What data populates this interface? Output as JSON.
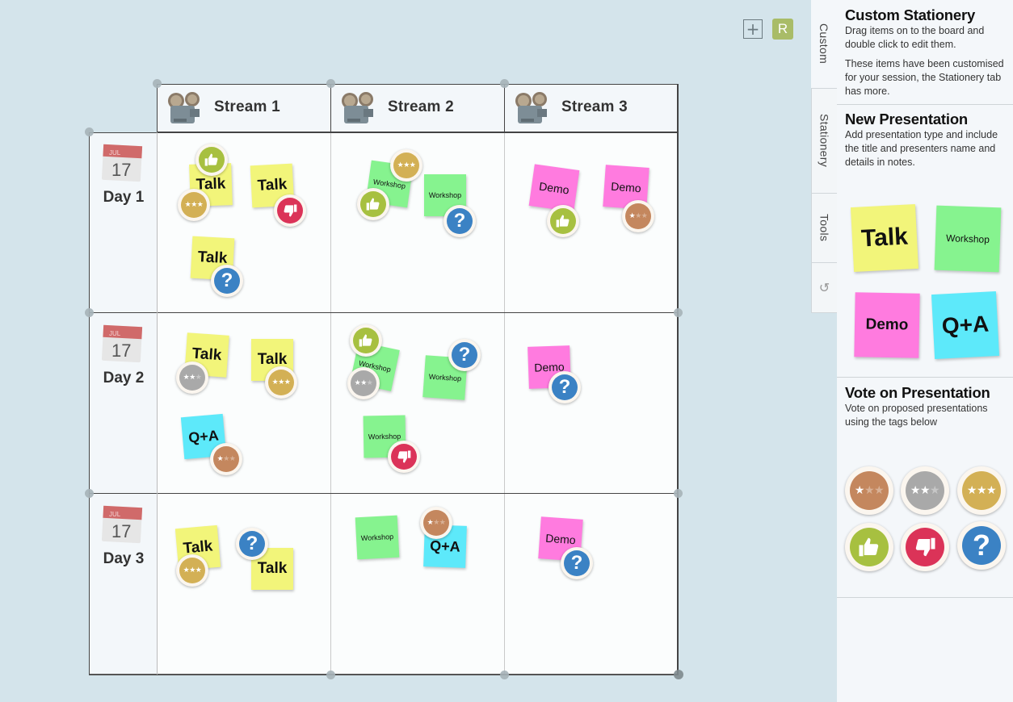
{
  "board": {
    "controls": {
      "add_label": "+",
      "user_initial": "R"
    },
    "columns": [
      {
        "label": "Stream 1",
        "icon": "film-projector-icon"
      },
      {
        "label": "Stream 2",
        "icon": "film-projector-icon"
      },
      {
        "label": "Stream 3",
        "icon": "film-projector-icon"
      }
    ],
    "rows": [
      {
        "label": "Day 1",
        "icon": "calendar-icon",
        "calendar_month": "JUL",
        "calendar_day": "17"
      },
      {
        "label": "Day 2",
        "icon": "calendar-icon",
        "calendar_month": "JUL",
        "calendar_day": "17"
      },
      {
        "label": "Day 3",
        "icon": "calendar-icon",
        "calendar_month": "JUL",
        "calendar_day": "17"
      }
    ],
    "notes": [
      {
        "type": "talk",
        "label": "Talk",
        "row": 1,
        "col": 1
      },
      {
        "type": "talk",
        "label": "Talk",
        "row": 1,
        "col": 1
      },
      {
        "type": "talk",
        "label": "Talk",
        "row": 1,
        "col": 1
      },
      {
        "type": "workshop",
        "label": "Workshop",
        "row": 1,
        "col": 2
      },
      {
        "type": "workshop",
        "label": "Workshop",
        "row": 1,
        "col": 2
      },
      {
        "type": "demo",
        "label": "Demo",
        "row": 1,
        "col": 3
      },
      {
        "type": "demo",
        "label": "Demo",
        "row": 1,
        "col": 3
      },
      {
        "type": "talk",
        "label": "Talk",
        "row": 2,
        "col": 1
      },
      {
        "type": "talk",
        "label": "Talk",
        "row": 2,
        "col": 1
      },
      {
        "type": "qa",
        "label": "Q+A",
        "row": 2,
        "col": 1
      },
      {
        "type": "workshop",
        "label": "Workshop",
        "row": 2,
        "col": 2
      },
      {
        "type": "workshop",
        "label": "Workshop",
        "row": 2,
        "col": 2
      },
      {
        "type": "workshop",
        "label": "Workshop",
        "row": 2,
        "col": 2
      },
      {
        "type": "demo",
        "label": "Demo",
        "row": 2,
        "col": 3
      },
      {
        "type": "talk",
        "label": "Talk",
        "row": 3,
        "col": 1
      },
      {
        "type": "talk",
        "label": "Talk",
        "row": 3,
        "col": 1
      },
      {
        "type": "workshop",
        "label": "Workshop",
        "row": 3,
        "col": 2
      },
      {
        "type": "qa",
        "label": "Q+A",
        "row": 3,
        "col": 2
      },
      {
        "type": "demo",
        "label": "Demo",
        "row": 3,
        "col": 3
      }
    ],
    "tags": [
      {
        "kind": "thumbs-up",
        "note": 0
      },
      {
        "kind": "gold-3-star",
        "note": 0
      },
      {
        "kind": "thumbs-down",
        "note": 1
      },
      {
        "kind": "question",
        "note": 2
      },
      {
        "kind": "gold-3-star",
        "note": 3
      },
      {
        "kind": "thumbs-up",
        "note": 3
      },
      {
        "kind": "question",
        "note": 4
      },
      {
        "kind": "thumbs-up",
        "note": 5
      },
      {
        "kind": "bronze-1-star",
        "note": 6
      },
      {
        "kind": "silver-2-star",
        "note": 7
      },
      {
        "kind": "gold-3-star",
        "note": 8
      },
      {
        "kind": "bronze-1-star",
        "note": 9
      },
      {
        "kind": "thumbs-up",
        "note": 10
      },
      {
        "kind": "silver-2-star",
        "note": 10
      },
      {
        "kind": "question",
        "note": 11
      },
      {
        "kind": "thumbs-down",
        "note": 12
      },
      {
        "kind": "question",
        "note": 13
      },
      {
        "kind": "gold-3-star",
        "note": 14
      },
      {
        "kind": "question",
        "note": 15
      },
      {
        "kind": "bronze-1-star",
        "note": 17
      },
      {
        "kind": "question",
        "note": 18
      }
    ]
  },
  "tabs": [
    {
      "label": "Custom",
      "active": true
    },
    {
      "label": "Stationery",
      "active": false
    },
    {
      "label": "Tools",
      "active": false
    },
    {
      "label": "undo",
      "icon": "undo-icon"
    }
  ],
  "panel": {
    "custom": {
      "title": "Custom Stationery",
      "desc1": "Drag items on to the board and double click to edit them.",
      "desc2": "These items have been customised for your session, the Stationery tab has more."
    },
    "new_presentation": {
      "title": "New Presentation",
      "desc": "Add presentation type and include the title and presenters name and details in notes.",
      "items": [
        {
          "type": "talk",
          "label": "Talk"
        },
        {
          "type": "workshop",
          "label": "Workshop"
        },
        {
          "type": "demo",
          "label": "Demo"
        },
        {
          "type": "qa",
          "label": "Q+A"
        }
      ]
    },
    "vote": {
      "title": "Vote on Presentation",
      "desc": "Vote on proposed presentations using the tags below",
      "tags": [
        "bronze-1-star",
        "silver-2-star",
        "gold-3-star",
        "thumbs-up",
        "thumbs-down",
        "question"
      ]
    }
  },
  "colors": {
    "talk": "#f2f57a",
    "workshop": "#86f38f",
    "demo": "#ff7bdf",
    "qa": "#5de9fa",
    "gold": "#d3b055",
    "silver": "#a9a9a9",
    "bronze": "#c4875e",
    "thumbs_up": "#a7c040",
    "thumbs_down": "#db3358",
    "question": "#3b82c4",
    "user_badge": "#a9bc68",
    "background": "#d4e4eb"
  }
}
